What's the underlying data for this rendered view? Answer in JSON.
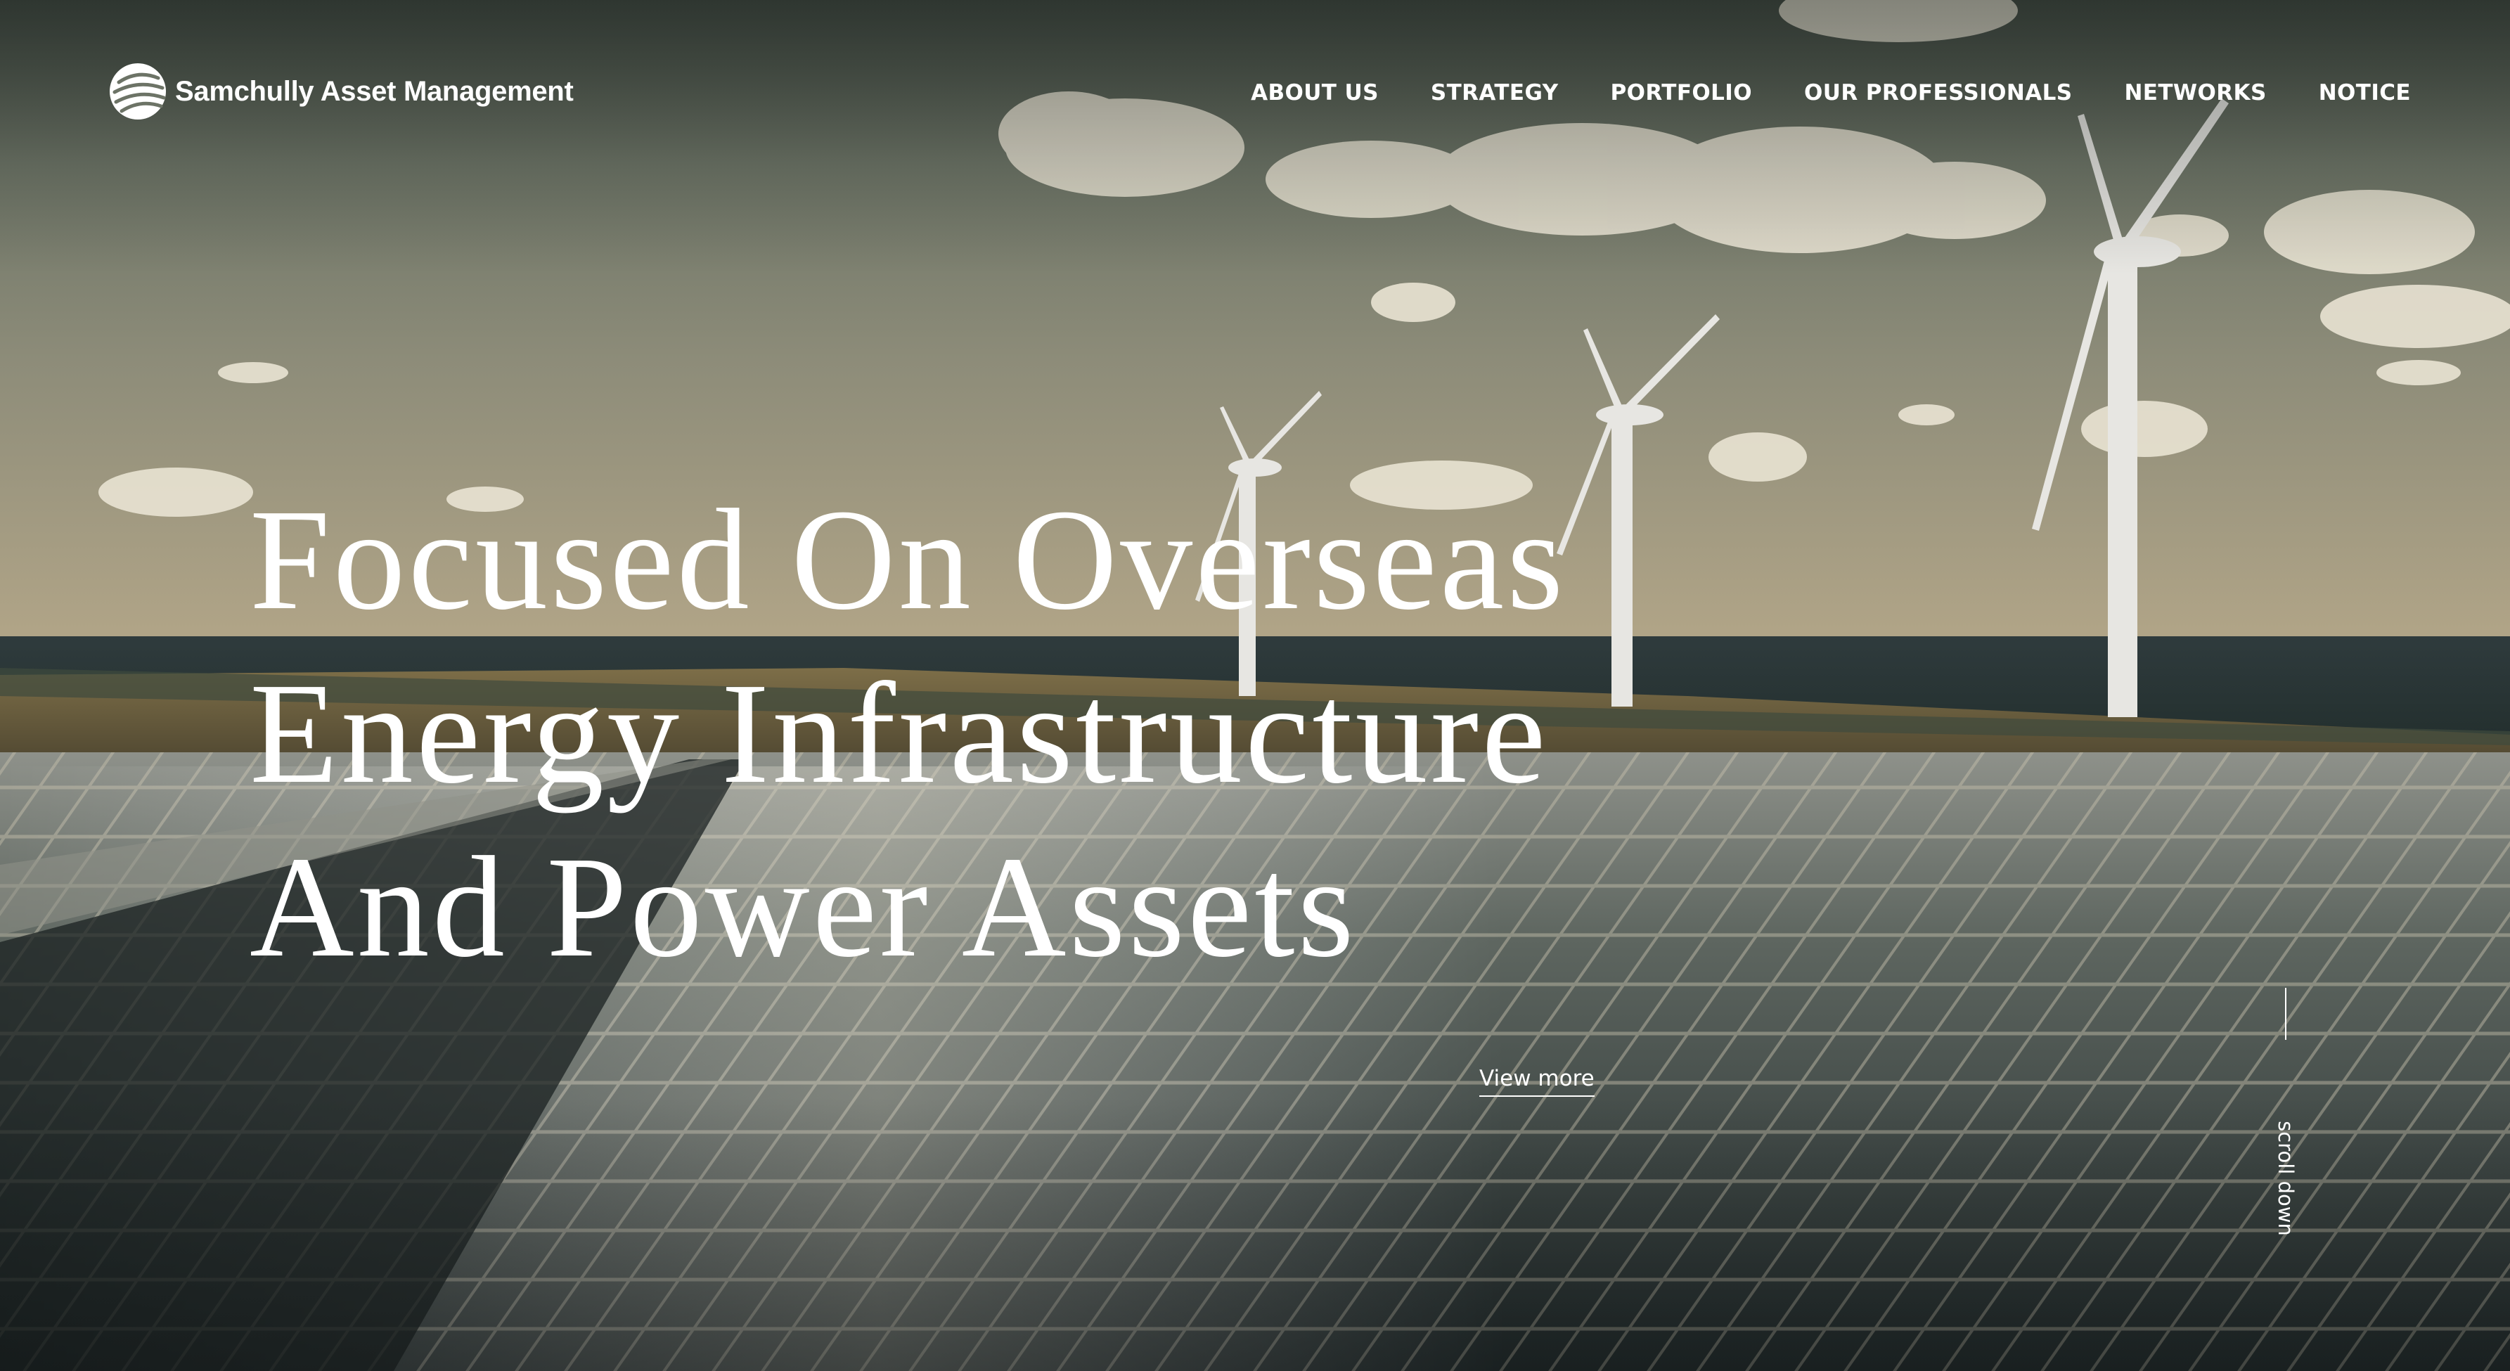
{
  "brand": {
    "name": "Samchully Asset Management",
    "logo_icon": "globe-stripes-icon"
  },
  "nav": {
    "items": [
      {
        "label": "ABOUT US"
      },
      {
        "label": "STRATEGY"
      },
      {
        "label": "PORTFOLIO"
      },
      {
        "label": "OUR PROFESSIONALS"
      },
      {
        "label": "NETWORKS"
      },
      {
        "label": "NOTICE"
      }
    ]
  },
  "hero": {
    "headline_lines": [
      "Focused On Overseas",
      "Energy Infrastructure",
      "And Power Assets"
    ],
    "cta_label": "View more",
    "scroll_label": "scroll down",
    "background_image": "wind turbines and solar panels",
    "text_color": "#ffffff"
  }
}
